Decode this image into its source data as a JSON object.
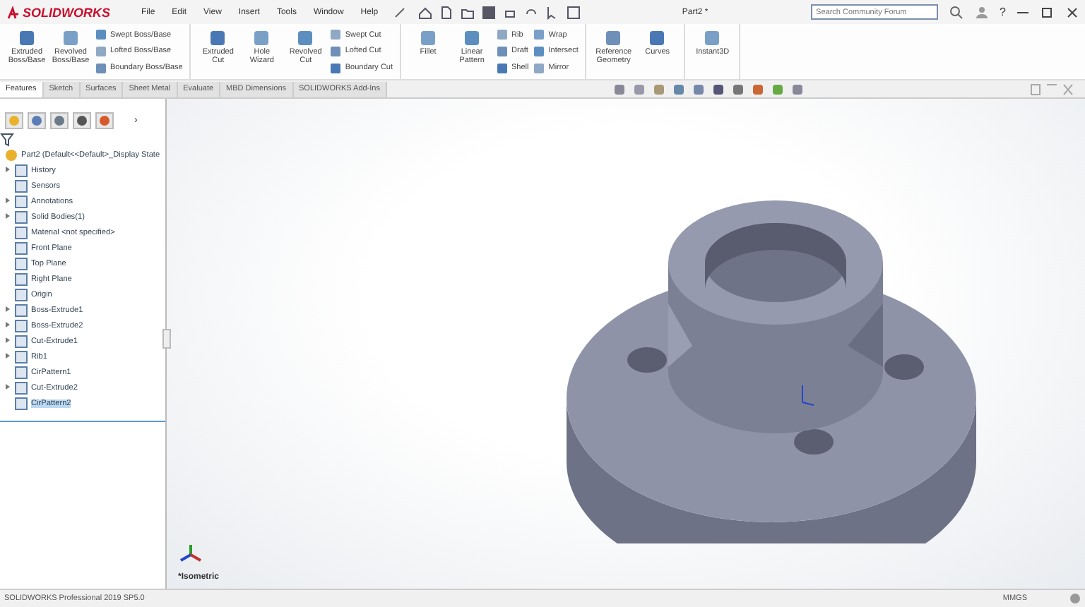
{
  "app": {
    "logo": "SOLIDWORKS",
    "menu": [
      "File",
      "Edit",
      "View",
      "Insert",
      "Tools",
      "Window",
      "Help"
    ],
    "title": "Part2 *",
    "help": "?",
    "search": {
      "placeholder": "Search Community Forum"
    }
  },
  "ribbon": {
    "groups": [
      {
        "columns": [
          {
            "kind": "large",
            "label": "Extruded Boss/Base"
          },
          {
            "kind": "large",
            "label": "Revolved Boss/Base"
          },
          {
            "kind": "stack",
            "items": [
              "Swept Boss/Base",
              "Lofted Boss/Base",
              "Boundary Boss/Base"
            ]
          }
        ]
      },
      {
        "columns": [
          {
            "kind": "large",
            "label": "Extruded Cut"
          },
          {
            "kind": "large",
            "label": "Hole Wizard"
          },
          {
            "kind": "large",
            "label": "Revolved Cut"
          },
          {
            "kind": "stack",
            "items": [
              "Swept Cut",
              "Lofted Cut",
              "Boundary Cut"
            ]
          }
        ]
      },
      {
        "columns": [
          {
            "kind": "large",
            "label": "Fillet"
          },
          {
            "kind": "large",
            "label": "Linear Pattern"
          },
          {
            "kind": "stack",
            "items": [
              "Rib",
              "Draft",
              "Shell"
            ]
          },
          {
            "kind": "stack",
            "items": [
              "Wrap",
              "Intersect",
              "Mirror"
            ]
          }
        ]
      },
      {
        "columns": [
          {
            "kind": "large",
            "label": "Reference Geometry"
          },
          {
            "kind": "large",
            "label": "Curves"
          }
        ]
      },
      {
        "columns": [
          {
            "kind": "large",
            "label": "Instant3D"
          }
        ]
      }
    ]
  },
  "tabs": [
    {
      "label": "Features",
      "selected": true
    },
    {
      "label": "Sketch",
      "selected": false
    },
    {
      "label": "Surfaces",
      "selected": false
    },
    {
      "label": "Sheet Metal",
      "selected": false
    },
    {
      "label": "Evaluate",
      "selected": false
    },
    {
      "label": "MBD Dimensions",
      "selected": false
    },
    {
      "label": "SOLIDWORKS Add-Ins",
      "selected": false
    }
  ],
  "tree": {
    "more": "›",
    "root": "Part2  (Default<<Default>_Display State",
    "items": [
      {
        "label": "History",
        "expandable": true,
        "selected": false
      },
      {
        "label": "Sensors",
        "expandable": false,
        "selected": false
      },
      {
        "label": "Annotations",
        "expandable": true,
        "selected": false
      },
      {
        "label": "Solid Bodies(1)",
        "expandable": true,
        "selected": false
      },
      {
        "label": "Material <not specified>",
        "expandable": false,
        "selected": false
      },
      {
        "label": "Front Plane",
        "expandable": false,
        "selected": false
      },
      {
        "label": "Top Plane",
        "expandable": false,
        "selected": false
      },
      {
        "label": "Right Plane",
        "expandable": false,
        "selected": false
      },
      {
        "label": "Origin",
        "expandable": false,
        "selected": false
      },
      {
        "label": "Boss-Extrude1",
        "expandable": true,
        "selected": false
      },
      {
        "label": "Boss-Extrude2",
        "expandable": true,
        "selected": false
      },
      {
        "label": "Cut-Extrude1",
        "expandable": true,
        "selected": false
      },
      {
        "label": "Rib1",
        "expandable": true,
        "selected": false
      },
      {
        "label": "CirPattern1",
        "expandable": false,
        "selected": false
      },
      {
        "label": "Cut-Extrude2",
        "expandable": true,
        "selected": false
      },
      {
        "label": "CirPattern2",
        "expandable": false,
        "selected": true
      }
    ]
  },
  "viewport": {
    "view_label": "*Isometric"
  },
  "status_bar": {
    "text": "SOLIDWORKS Professional 2019 SP5.0",
    "units": "MMGS"
  }
}
